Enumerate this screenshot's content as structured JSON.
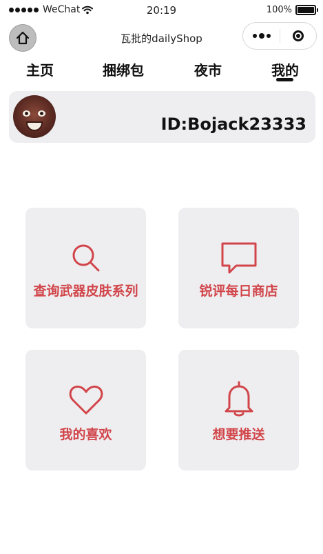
{
  "status_bar": {
    "carrier": "WeChat",
    "time": "20:19",
    "battery": "100%"
  },
  "nav_bar": {
    "title": "瓦批的dailyShop"
  },
  "tabs": [
    {
      "label": "主页",
      "active": false
    },
    {
      "label": "捆绑包",
      "active": false
    },
    {
      "label": "夜市",
      "active": false
    },
    {
      "label": "我的",
      "active": true
    }
  ],
  "profile": {
    "id_text": "ID:Bojack23333"
  },
  "menu": [
    {
      "label": "查询武器皮肤系列",
      "icon": "search-icon"
    },
    {
      "label": "锐评每日商店",
      "icon": "chat-bubble-icon"
    },
    {
      "label": "我的喜欢",
      "icon": "heart-icon"
    },
    {
      "label": "想要推送",
      "icon": "bell-icon"
    }
  ],
  "colors": {
    "accent": "#d1454a",
    "card_background": "#eeeef0",
    "text": "#111111"
  }
}
